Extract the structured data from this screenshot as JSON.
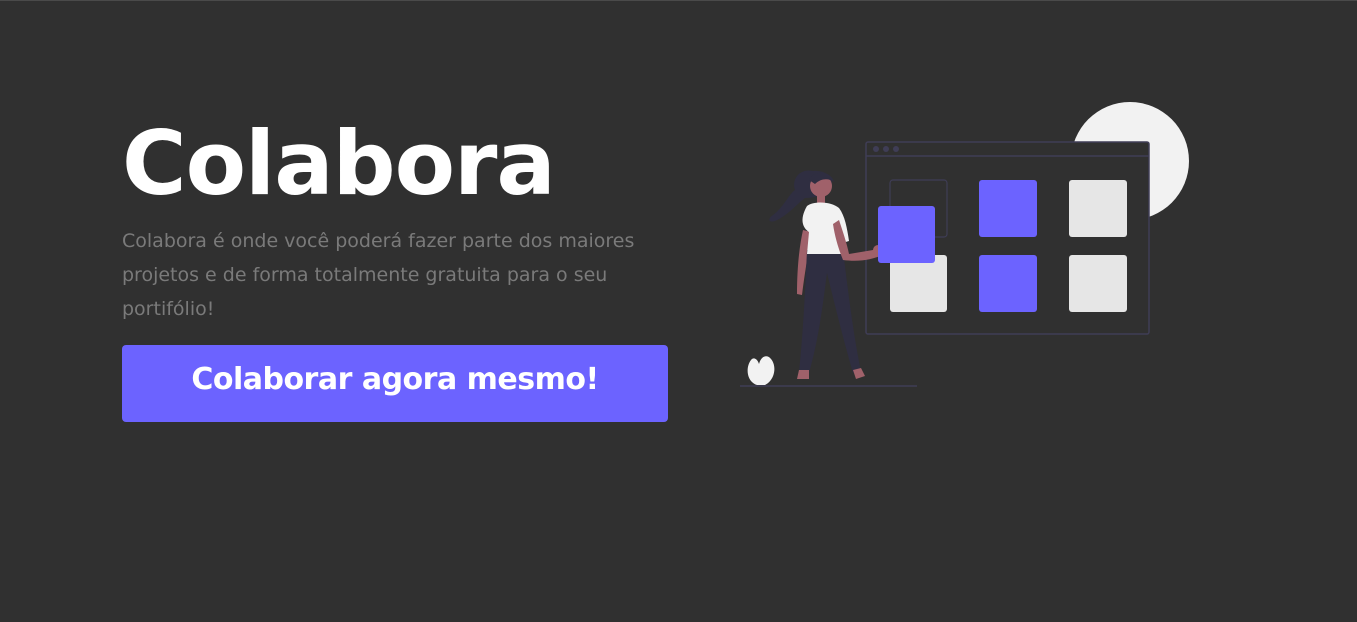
{
  "hero": {
    "title": "Colabora",
    "description": "Colabora é onde você poderá fazer parte dos maiores projetos e de forma totalmente gratuita para o seu portifólio!",
    "cta_label": "Colaborar agora mesmo!"
  },
  "colors": {
    "background": "#303030",
    "accent": "#6c63ff",
    "title": "#ffffff",
    "description": "#7a7a7a",
    "tile_light": "#e6e6e6"
  },
  "illustration": {
    "icon": "person-arranging-grid-illustration"
  }
}
